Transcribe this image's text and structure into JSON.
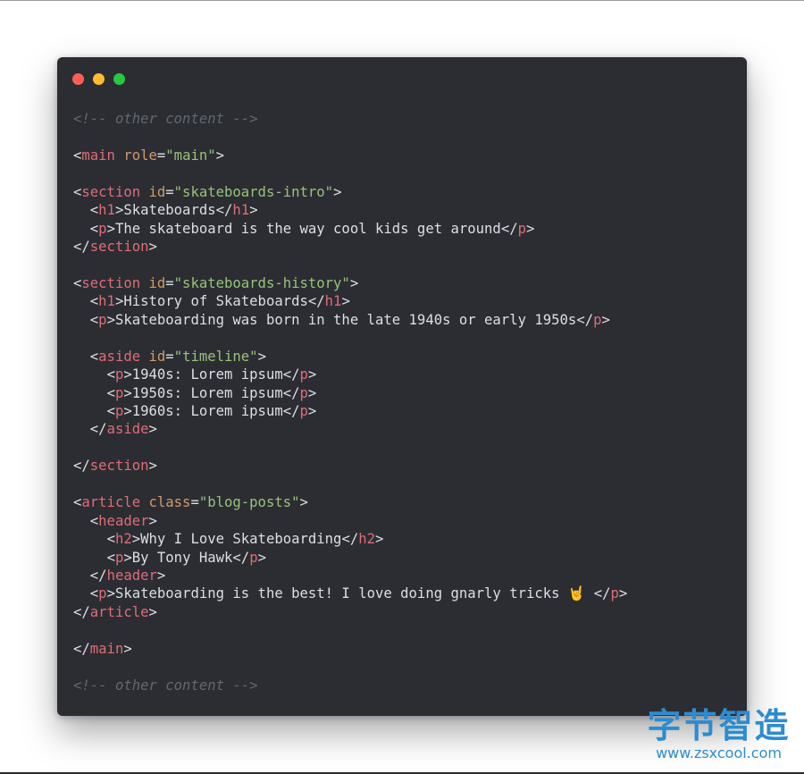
{
  "window": {
    "traffic_lights": [
      {
        "name": "close",
        "color": "#ff5f57"
      },
      {
        "name": "minimize",
        "color": "#febc2e"
      },
      {
        "name": "zoom",
        "color": "#28c840"
      }
    ]
  },
  "theme": {
    "background": "#2b2d33",
    "comment": "#626770",
    "tag": "#e06c75",
    "attribute": "#d19a66",
    "string": "#98c379",
    "text": "#dcdfe4"
  },
  "code_lines": [
    [
      {
        "t": "comment",
        "v": "<!-- other content -->"
      }
    ],
    [],
    [
      {
        "t": "punct",
        "v": "<"
      },
      {
        "t": "tag",
        "v": "main"
      },
      {
        "t": "text",
        "v": " "
      },
      {
        "t": "attr",
        "v": "role"
      },
      {
        "t": "punct",
        "v": "="
      },
      {
        "t": "string",
        "v": "\"main\""
      },
      {
        "t": "punct",
        "v": ">"
      }
    ],
    [],
    [
      {
        "t": "punct",
        "v": "<"
      },
      {
        "t": "tag",
        "v": "section"
      },
      {
        "t": "text",
        "v": " "
      },
      {
        "t": "attr",
        "v": "id"
      },
      {
        "t": "punct",
        "v": "="
      },
      {
        "t": "string",
        "v": "\"skateboards-intro\""
      },
      {
        "t": "punct",
        "v": ">"
      }
    ],
    [
      {
        "t": "text",
        "v": "  "
      },
      {
        "t": "punct",
        "v": "<"
      },
      {
        "t": "tag",
        "v": "h1"
      },
      {
        "t": "punct",
        "v": ">"
      },
      {
        "t": "text",
        "v": "Skateboards"
      },
      {
        "t": "punct",
        "v": "</"
      },
      {
        "t": "tag",
        "v": "h1"
      },
      {
        "t": "punct",
        "v": ">"
      }
    ],
    [
      {
        "t": "text",
        "v": "  "
      },
      {
        "t": "punct",
        "v": "<"
      },
      {
        "t": "tag",
        "v": "p"
      },
      {
        "t": "punct",
        "v": ">"
      },
      {
        "t": "text",
        "v": "The skateboard is the way cool kids get around"
      },
      {
        "t": "punct",
        "v": "</"
      },
      {
        "t": "tag",
        "v": "p"
      },
      {
        "t": "punct",
        "v": ">"
      }
    ],
    [
      {
        "t": "punct",
        "v": "</"
      },
      {
        "t": "tag",
        "v": "section"
      },
      {
        "t": "punct",
        "v": ">"
      }
    ],
    [],
    [
      {
        "t": "punct",
        "v": "<"
      },
      {
        "t": "tag",
        "v": "section"
      },
      {
        "t": "text",
        "v": " "
      },
      {
        "t": "attr",
        "v": "id"
      },
      {
        "t": "punct",
        "v": "="
      },
      {
        "t": "string",
        "v": "\"skateboards-history\""
      },
      {
        "t": "punct",
        "v": ">"
      }
    ],
    [
      {
        "t": "text",
        "v": "  "
      },
      {
        "t": "punct",
        "v": "<"
      },
      {
        "t": "tag",
        "v": "h1"
      },
      {
        "t": "punct",
        "v": ">"
      },
      {
        "t": "text",
        "v": "History of Skateboards"
      },
      {
        "t": "punct",
        "v": "</"
      },
      {
        "t": "tag",
        "v": "h1"
      },
      {
        "t": "punct",
        "v": ">"
      }
    ],
    [
      {
        "t": "text",
        "v": "  "
      },
      {
        "t": "punct",
        "v": "<"
      },
      {
        "t": "tag",
        "v": "p"
      },
      {
        "t": "punct",
        "v": ">"
      },
      {
        "t": "text",
        "v": "Skateboarding was born in the late 1940s or early 1950s"
      },
      {
        "t": "punct",
        "v": "</"
      },
      {
        "t": "tag",
        "v": "p"
      },
      {
        "t": "punct",
        "v": ">"
      }
    ],
    [],
    [
      {
        "t": "text",
        "v": "  "
      },
      {
        "t": "punct",
        "v": "<"
      },
      {
        "t": "tag",
        "v": "aside"
      },
      {
        "t": "text",
        "v": " "
      },
      {
        "t": "attr",
        "v": "id"
      },
      {
        "t": "punct",
        "v": "="
      },
      {
        "t": "string",
        "v": "\"timeline\""
      },
      {
        "t": "punct",
        "v": ">"
      }
    ],
    [
      {
        "t": "text",
        "v": "    "
      },
      {
        "t": "punct",
        "v": "<"
      },
      {
        "t": "tag",
        "v": "p"
      },
      {
        "t": "punct",
        "v": ">"
      },
      {
        "t": "text",
        "v": "1940s: Lorem ipsum"
      },
      {
        "t": "punct",
        "v": "</"
      },
      {
        "t": "tag",
        "v": "p"
      },
      {
        "t": "punct",
        "v": ">"
      }
    ],
    [
      {
        "t": "text",
        "v": "    "
      },
      {
        "t": "punct",
        "v": "<"
      },
      {
        "t": "tag",
        "v": "p"
      },
      {
        "t": "punct",
        "v": ">"
      },
      {
        "t": "text",
        "v": "1950s: Lorem ipsum"
      },
      {
        "t": "punct",
        "v": "</"
      },
      {
        "t": "tag",
        "v": "p"
      },
      {
        "t": "punct",
        "v": ">"
      }
    ],
    [
      {
        "t": "text",
        "v": "    "
      },
      {
        "t": "punct",
        "v": "<"
      },
      {
        "t": "tag",
        "v": "p"
      },
      {
        "t": "punct",
        "v": ">"
      },
      {
        "t": "text",
        "v": "1960s: Lorem ipsum"
      },
      {
        "t": "punct",
        "v": "</"
      },
      {
        "t": "tag",
        "v": "p"
      },
      {
        "t": "punct",
        "v": ">"
      }
    ],
    [
      {
        "t": "text",
        "v": "  "
      },
      {
        "t": "punct",
        "v": "</"
      },
      {
        "t": "tag",
        "v": "aside"
      },
      {
        "t": "punct",
        "v": ">"
      }
    ],
    [],
    [
      {
        "t": "punct",
        "v": "</"
      },
      {
        "t": "tag",
        "v": "section"
      },
      {
        "t": "punct",
        "v": ">"
      }
    ],
    [],
    [
      {
        "t": "punct",
        "v": "<"
      },
      {
        "t": "tag",
        "v": "article"
      },
      {
        "t": "text",
        "v": " "
      },
      {
        "t": "attr",
        "v": "class"
      },
      {
        "t": "punct",
        "v": "="
      },
      {
        "t": "string",
        "v": "\"blog-posts\""
      },
      {
        "t": "punct",
        "v": ">"
      }
    ],
    [
      {
        "t": "text",
        "v": "  "
      },
      {
        "t": "punct",
        "v": "<"
      },
      {
        "t": "tag",
        "v": "header"
      },
      {
        "t": "punct",
        "v": ">"
      }
    ],
    [
      {
        "t": "text",
        "v": "    "
      },
      {
        "t": "punct",
        "v": "<"
      },
      {
        "t": "tag",
        "v": "h2"
      },
      {
        "t": "punct",
        "v": ">"
      },
      {
        "t": "text",
        "v": "Why I Love Skateboarding"
      },
      {
        "t": "punct",
        "v": "</"
      },
      {
        "t": "tag",
        "v": "h2"
      },
      {
        "t": "punct",
        "v": ">"
      }
    ],
    [
      {
        "t": "text",
        "v": "    "
      },
      {
        "t": "punct",
        "v": "<"
      },
      {
        "t": "tag",
        "v": "p"
      },
      {
        "t": "punct",
        "v": ">"
      },
      {
        "t": "text",
        "v": "By Tony Hawk"
      },
      {
        "t": "punct",
        "v": "</"
      },
      {
        "t": "tag",
        "v": "p"
      },
      {
        "t": "punct",
        "v": ">"
      }
    ],
    [
      {
        "t": "text",
        "v": "  "
      },
      {
        "t": "punct",
        "v": "</"
      },
      {
        "t": "tag",
        "v": "header"
      },
      {
        "t": "punct",
        "v": ">"
      }
    ],
    [
      {
        "t": "text",
        "v": "  "
      },
      {
        "t": "punct",
        "v": "<"
      },
      {
        "t": "tag",
        "v": "p"
      },
      {
        "t": "punct",
        "v": ">"
      },
      {
        "t": "text",
        "v": "Skateboarding is the best! I love doing gnarly tricks "
      },
      {
        "t": "emoji",
        "v": "🤘"
      },
      {
        "t": "text",
        "v": " "
      },
      {
        "t": "punct",
        "v": "</"
      },
      {
        "t": "tag",
        "v": "p"
      },
      {
        "t": "punct",
        "v": ">"
      }
    ],
    [
      {
        "t": "punct",
        "v": "</"
      },
      {
        "t": "tag",
        "v": "article"
      },
      {
        "t": "punct",
        "v": ">"
      }
    ],
    [],
    [
      {
        "t": "punct",
        "v": "</"
      },
      {
        "t": "tag",
        "v": "main"
      },
      {
        "t": "punct",
        "v": ">"
      }
    ],
    [],
    [
      {
        "t": "comment",
        "v": "<!-- other content -->"
      }
    ]
  ],
  "watermark": {
    "title": "字节智造",
    "url": "www.zsxcool.com"
  }
}
